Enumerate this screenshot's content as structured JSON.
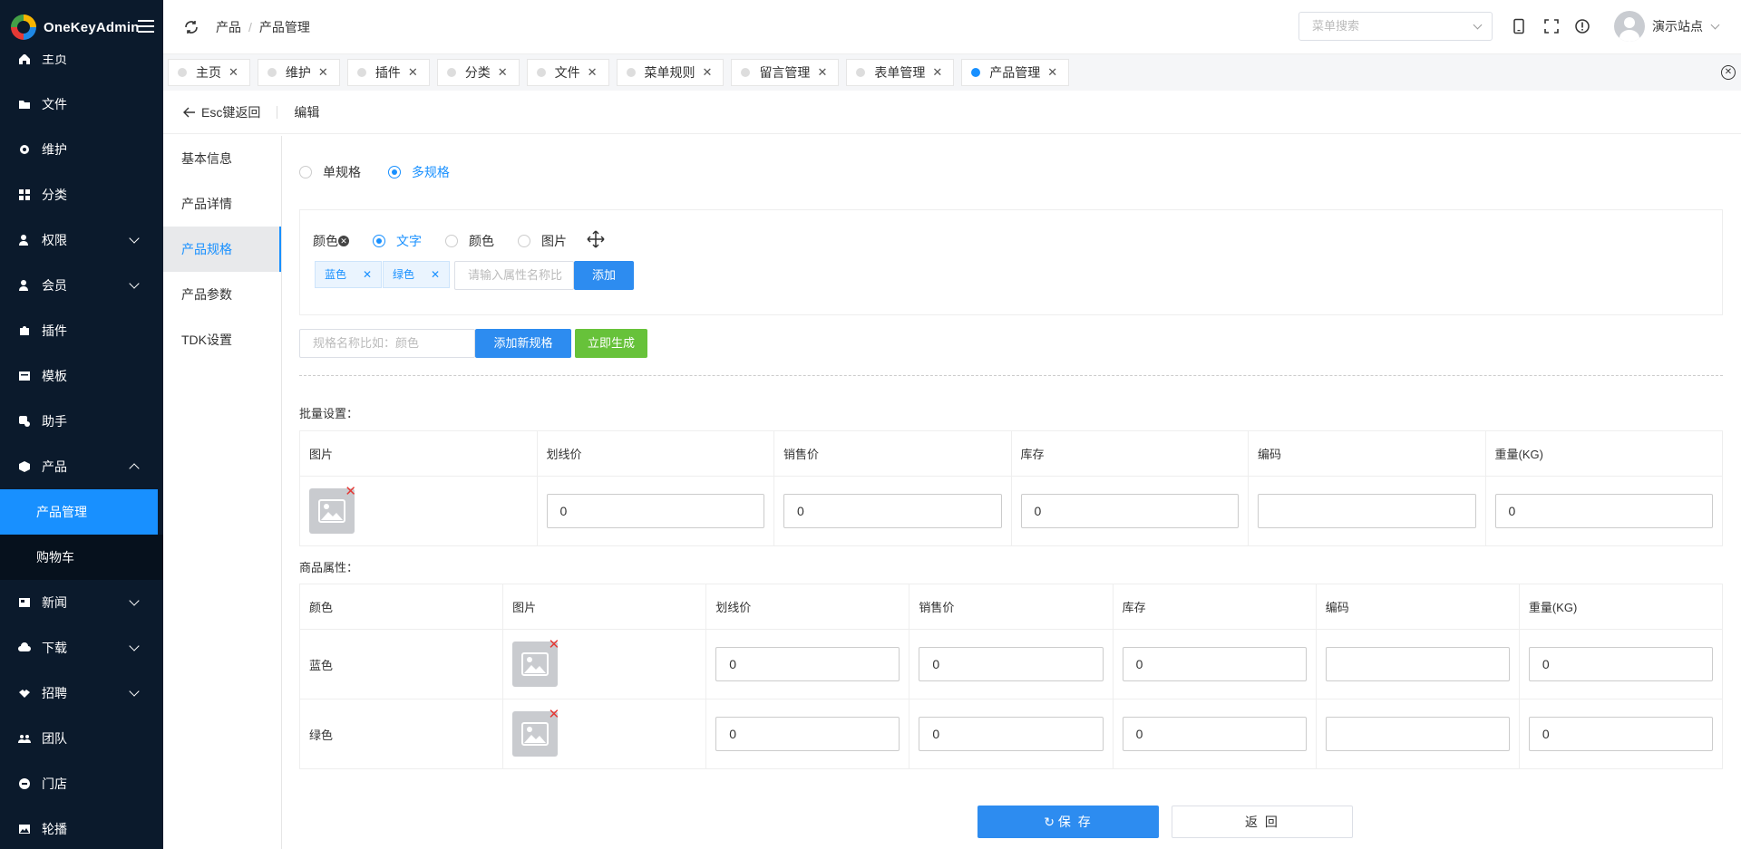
{
  "app": {
    "name": "OneKeyAdmin"
  },
  "sidebar": {
    "items": [
      {
        "label": "主页"
      },
      {
        "label": "文件"
      },
      {
        "label": "维护"
      },
      {
        "label": "分类"
      },
      {
        "label": "权限"
      },
      {
        "label": "会员"
      },
      {
        "label": "插件"
      },
      {
        "label": "模板"
      },
      {
        "label": "助手"
      },
      {
        "label": "产品"
      },
      {
        "label": "新闻"
      },
      {
        "label": "下载"
      },
      {
        "label": "招聘"
      },
      {
        "label": "团队"
      },
      {
        "label": "门店"
      },
      {
        "label": "轮播"
      }
    ],
    "product_sub": [
      "产品管理",
      "购物车"
    ]
  },
  "header": {
    "breadcrumb": [
      "产品",
      "产品管理"
    ],
    "menu_search_placeholder": "菜单搜索",
    "user_name": "演示站点"
  },
  "tabs": [
    "主页",
    "维护",
    "插件",
    "分类",
    "文件",
    "菜单规则",
    "留言管理",
    "表单管理",
    "产品管理"
  ],
  "subheader": {
    "back": "Esc键返回",
    "title": "编辑"
  },
  "leftnav": [
    "基本信息",
    "产品详情",
    "产品规格",
    "产品参数",
    "TDK设置"
  ],
  "spec": {
    "mode_single": "单规格",
    "mode_multi": "多规格",
    "attr_name": "颜色",
    "type_text": "文字",
    "type_color": "颜色",
    "type_image": "图片",
    "values": [
      "蓝色",
      "绿色"
    ],
    "attr_input_placeholder": "请输入属性名称比",
    "add_btn": "添加",
    "spec_name_placeholder": "规格名称比如：颜色",
    "add_spec_btn": "添加新规格",
    "generate_btn": "立即生成"
  },
  "batch": {
    "label": "批量设置：",
    "headers": [
      "图片",
      "划线价",
      "销售价",
      "库存",
      "编码",
      "重量(KG)"
    ],
    "values": [
      "0",
      "0",
      "0",
      "",
      "0"
    ]
  },
  "attrs": {
    "label": "商品属性：",
    "headers": [
      "颜色",
      "图片",
      "划线价",
      "销售价",
      "库存",
      "编码",
      "重量(KG)"
    ],
    "rows": [
      {
        "name": "蓝色",
        "values": [
          "0",
          "0",
          "0",
          "",
          "0"
        ]
      },
      {
        "name": "绿色",
        "values": [
          "0",
          "0",
          "0",
          "",
          "0"
        ]
      }
    ]
  },
  "actions": {
    "save": "保 存",
    "back": "返 回"
  },
  "colors": {
    "sidebar_bg": "#0b1a2c",
    "accent": "#1890ff",
    "green": "#67c23a"
  }
}
